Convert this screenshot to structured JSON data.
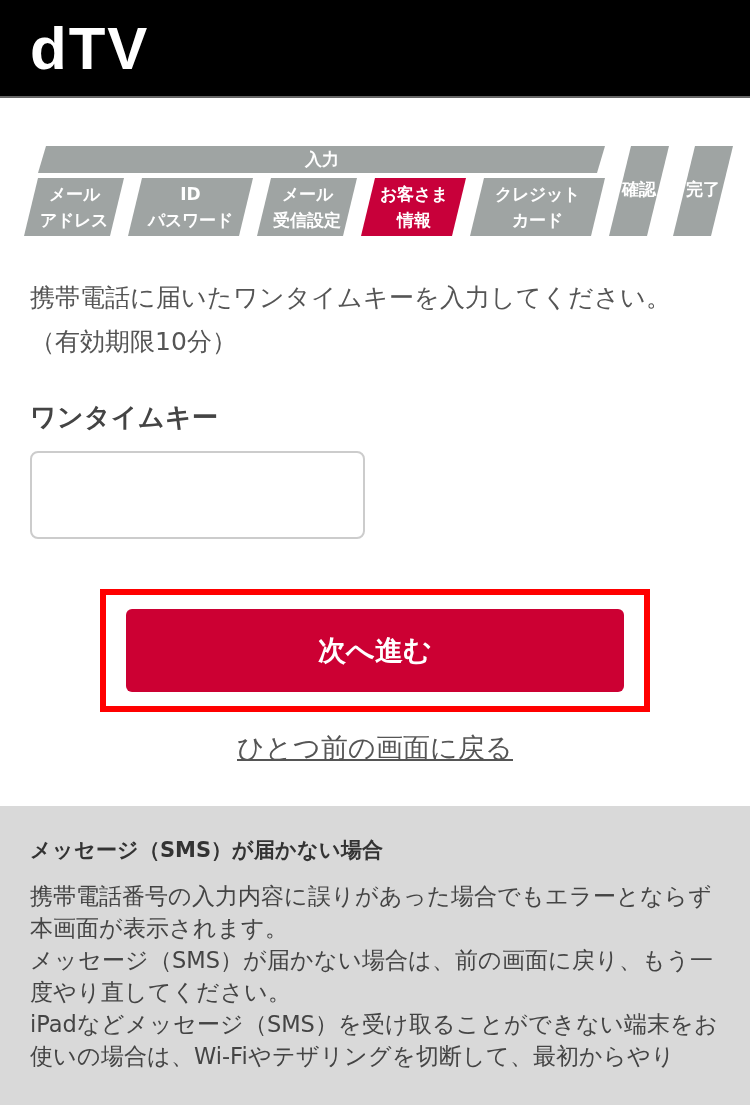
{
  "header": {
    "logo": "dTV"
  },
  "progress": {
    "group_label": "入力",
    "steps": [
      {
        "lines": [
          "メール",
          "アドレス"
        ],
        "kind": "input",
        "selected": false
      },
      {
        "lines": [
          "ID",
          "パスワード"
        ],
        "kind": "input",
        "selected": false
      },
      {
        "lines": [
          "メール",
          "受信設定"
        ],
        "kind": "input",
        "selected": false
      },
      {
        "lines": [
          "お客さま",
          "情報"
        ],
        "kind": "input",
        "selected": true
      },
      {
        "lines": [
          "クレジット",
          "カード"
        ],
        "kind": "input",
        "selected": false
      },
      {
        "lines": [
          "確認"
        ],
        "kind": "final",
        "selected": false
      },
      {
        "lines": [
          "完了"
        ],
        "kind": "final",
        "selected": false
      }
    ]
  },
  "instruction": "携帯電話に届いたワンタイムキーを入力してください。（有効期限10分）",
  "field": {
    "label": "ワンタイムキー"
  },
  "submit_button": "次へ進む",
  "back_link": "ひとつ前の画面に戻る",
  "notice": {
    "title": "メッセージ（SMS）が届かない場合",
    "paragraphs": [
      "携帯電話番号の入力内容に誤りがあった場合でもエラーとならず本画面が表示されます。",
      "メッセージ（SMS）が届かない場合は、前の画面に戻り、もう一度やり直してください。",
      "iPadなどメッセージ（SMS）を受け取ることができない端末をお使いの場合は、Wi-Fiやテザリングを切断して、最初からやり"
    ]
  }
}
